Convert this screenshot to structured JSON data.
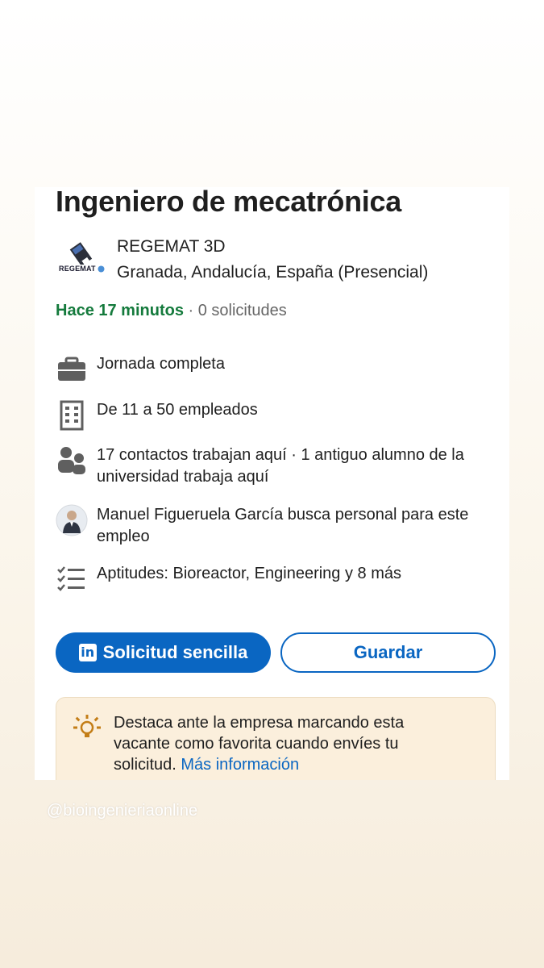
{
  "job": {
    "title": "Ingeniero de mecatrónica",
    "company_name": "REGEMAT 3D",
    "company_logo_text": "REGEMAT",
    "location": "Granada, Andalucía, España (Presencial)",
    "posted": "Hace 17 minutos",
    "separator": " · ",
    "applicants": "0 solicitudes"
  },
  "insights": [
    {
      "icon": "briefcase-icon",
      "text": "Jornada completa"
    },
    {
      "icon": "building-icon",
      "text": "De 11 a 50 empleados"
    },
    {
      "icon": "people-icon",
      "text": "17 contactos trabajan aquí · 1 antiguo alumno de la universidad trabaja aquí"
    },
    {
      "icon": "recruiter-avatar",
      "text": "Manuel Figueruela García busca personal para este empleo"
    },
    {
      "icon": "checklist-icon",
      "text": "Aptitudes: Bioreactor, Engineering y 8 más"
    }
  ],
  "actions": {
    "apply_label": "Solicitud sencilla",
    "apply_icon_text": "in",
    "save_label": "Guardar"
  },
  "tip": {
    "text": "Destaca ante la empresa marcando esta vacante como favorita cuando envíes tu solicitud. ",
    "link": "Más información"
  },
  "watermark": "@bioingenieriaonline",
  "colors": {
    "primary": "#0a66c2",
    "posted_green": "#147a3c",
    "tip_bg": "#fbefdc",
    "bulb": "#c37d16"
  }
}
